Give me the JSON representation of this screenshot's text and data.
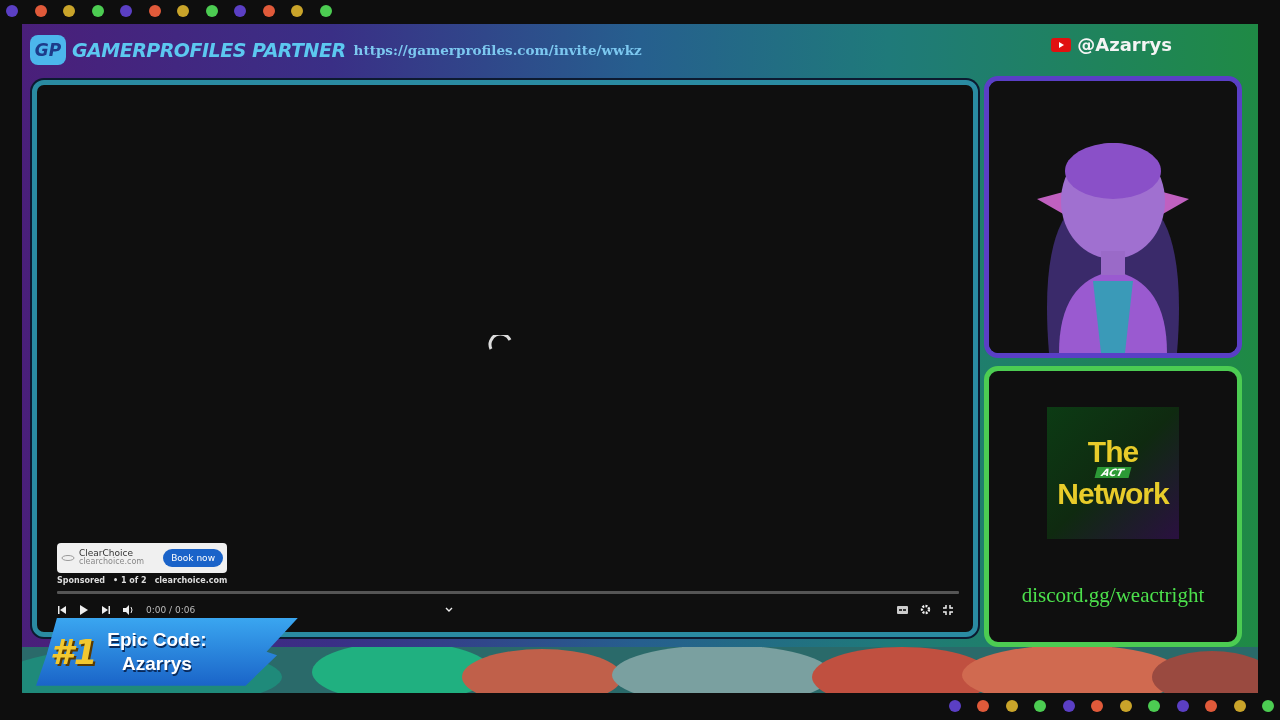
{
  "top_dots": [
    {
      "color": "#5b3fc4"
    },
    {
      "color": "#e05a3a"
    },
    {
      "color": "#c9a42a"
    },
    {
      "color": "#4ccc52"
    },
    {
      "color": "#5b3fc4"
    },
    {
      "color": "#e05a3a"
    },
    {
      "color": "#c9a42a"
    },
    {
      "color": "#4ccc52"
    },
    {
      "color": "#5b3fc4"
    },
    {
      "color": "#e05a3a"
    },
    {
      "color": "#c9a42a"
    },
    {
      "color": "#4ccc52"
    }
  ],
  "header": {
    "logo": "GP",
    "brand": "GAMERPROFILES PARTNER",
    "url": "https://gamerprofiles.com/invite/wwkz",
    "handle": "@Azarrys"
  },
  "player": {
    "ad": {
      "advertiser": "ClearChoice",
      "domain": "clearchoice.com",
      "button": "Book now",
      "sponsored": "Sponsored",
      "info": "• 1 of 2",
      "site": "clearchoice.com"
    },
    "time": "0:00 / 0:06"
  },
  "badge": {
    "rank": "#1",
    "title": "Epic Code:",
    "code": "Azarrys"
  },
  "network": {
    "top": "The",
    "middle": "ACT",
    "bottom": "Network"
  },
  "discord": "discord.gg/weactright",
  "bottom_dots": [
    {
      "color": "#5b3fc4"
    },
    {
      "color": "#e05a3a"
    },
    {
      "color": "#c9a42a"
    },
    {
      "color": "#4ccc52"
    },
    {
      "color": "#5b3fc4"
    },
    {
      "color": "#e05a3a"
    },
    {
      "color": "#c9a42a"
    },
    {
      "color": "#4ccc52"
    },
    {
      "color": "#5b3fc4"
    },
    {
      "color": "#e05a3a"
    },
    {
      "color": "#c9a42a"
    },
    {
      "color": "#4ccc52"
    }
  ]
}
